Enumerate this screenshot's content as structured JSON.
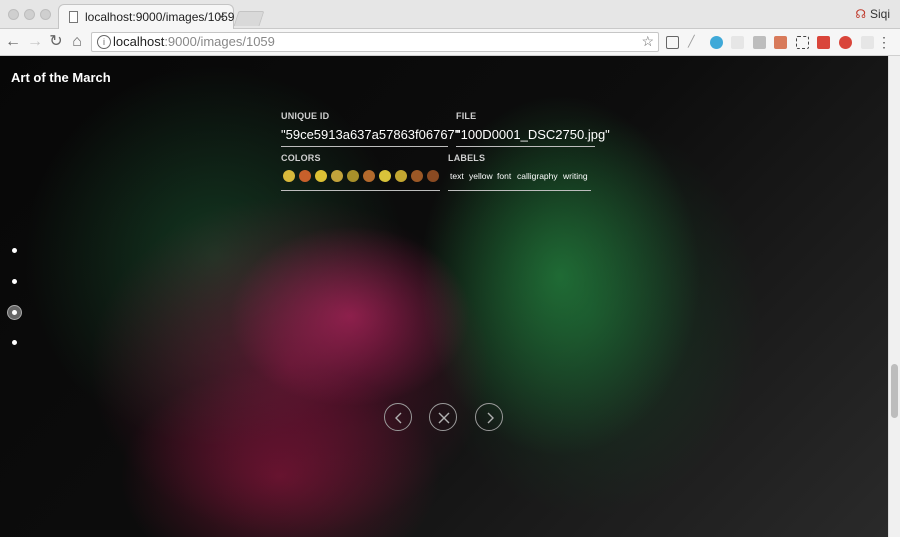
{
  "browser": {
    "tab_title": "localhost:9000/images/1059",
    "tab_close": "×",
    "profile_name": "Siqi",
    "url_host": "localhost",
    "url_rest": ":9000/images/1059"
  },
  "page": {
    "site_title": "Art of the March",
    "unique_id_label": "UNIQUE ID",
    "unique_id_value": "\"59ce5913a637a57863f06767\"",
    "file_label": "FILE",
    "file_value": "\"100D0001_DSC2750.jpg\"",
    "colors_label": "COLORS",
    "labels_label": "LABELS",
    "colors": [
      "#d8b93b",
      "#c8602b",
      "#dcc034",
      "#c3a33b",
      "#a8902a",
      "#b46a2c",
      "#d9c33a",
      "#c3a631",
      "#9c5826",
      "#8a4a22"
    ],
    "tags": [
      "text",
      "yellow",
      "font",
      "calligraphy",
      "writing"
    ],
    "nav": {
      "prev": "previous-image",
      "close": "close-viewer",
      "next": "next-image"
    }
  }
}
